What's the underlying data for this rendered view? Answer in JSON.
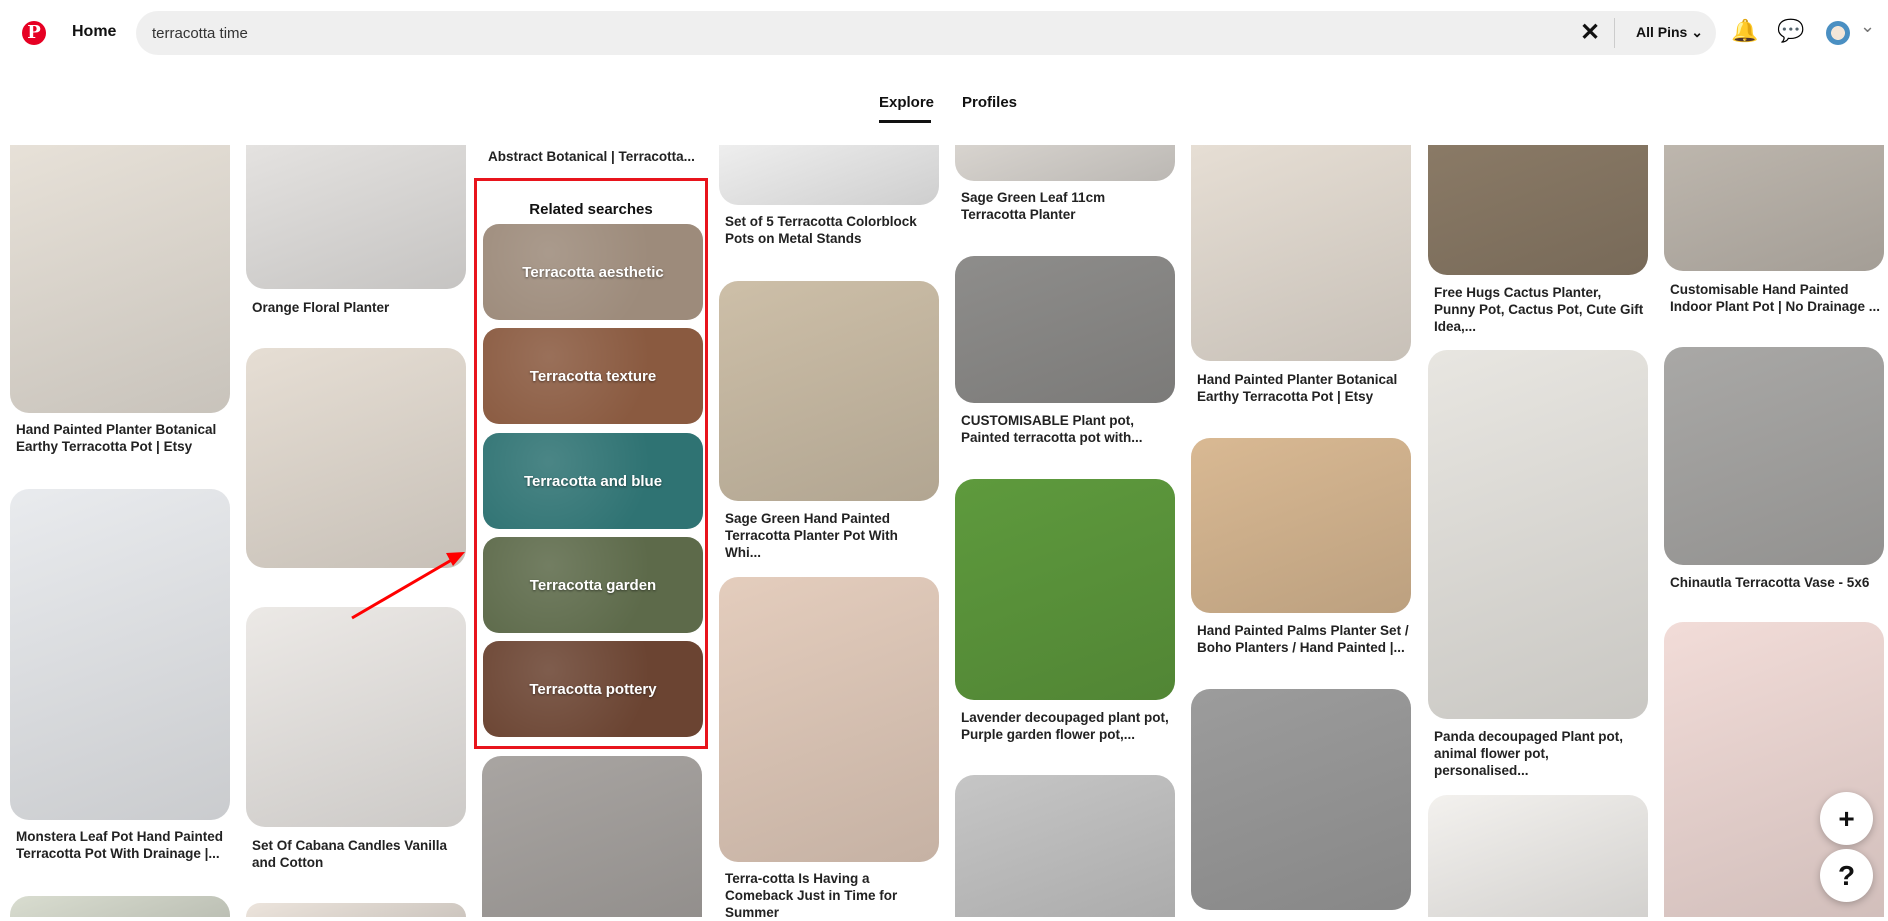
{
  "header": {
    "logo": "P",
    "home": "Home",
    "search_value": "terracotta time",
    "filter": "All Pins",
    "filter_chevron": "⌄",
    "clear": "✕",
    "bell": "🔔",
    "chat": "💬",
    "menu_chevron": "⌄"
  },
  "tabs": [
    {
      "label": "Explore",
      "active": true
    },
    {
      "label": "Profiles",
      "active": false
    }
  ],
  "columns": [
    [
      {
        "title": "Hand Painted Planter Botanical Earthy Terracotta Pot | Etsy",
        "color": "#e7e1d8"
      },
      {
        "title": "Monstera Leaf Pot Hand Painted Terracotta Pot With Drainage |...",
        "color": "#e9ebee"
      },
      {
        "title": "",
        "color": "#d9ddd0"
      }
    ],
    [
      {
        "title": "Orange Floral Planter",
        "color": "#e4e2e0"
      },
      {
        "title": "",
        "color": "#e6ded4"
      },
      {
        "title": "Set Of Cabana Candles Vanilla and Cotton",
        "color": "#ece9e6"
      },
      {
        "title": "",
        "color": "#ece4dc"
      }
    ],
    [
      {
        "title": "Abstract Botanical | Terracotta...",
        "color": "#ffffff"
      },
      {
        "title": "",
        "color": "#a9a5a2"
      }
    ],
    [
      {
        "title": "Set of 5 Terracotta Colorblock Pots on Metal Stands",
        "color": "#eeeeee"
      },
      {
        "title": "Sage Green Hand Painted Terracotta Planter Pot With Whi...",
        "color": "#cdbfa8"
      },
      {
        "title": "Terra-cotta Is Having a Comeback Just in Time for Summer",
        "color": "#e4cdbd"
      }
    ],
    [
      {
        "title": "Sage Green Leaf 11cm Terracotta Planter",
        "color": "#d8d4cf"
      },
      {
        "title": "CUSTOMISABLE Plant pot, Painted terracotta pot with...",
        "color": "#8e8d8b"
      },
      {
        "title": "Lavender decoupaged plant pot, Purple garden flower pot,...",
        "color": "#5e9a3d"
      },
      {
        "title": "",
        "color": "#c6c6c6"
      }
    ],
    [
      {
        "title": "Hand Painted Planter Botanical Earthy Terracotta Pot | Etsy",
        "color": "#e6ded4"
      },
      {
        "title": "Hand Painted Palms Planter Set / Boho Planters / Hand Painted |...",
        "color": "#d9b993"
      },
      {
        "title": "",
        "color": "#9c9c9c"
      }
    ],
    [
      {
        "title": "Free Hugs Cactus Planter, Punny Pot, Cactus Pot, Cute Gift Idea,...",
        "color": "#8a7a66"
      },
      {
        "title": "Panda decoupaged Plant pot, animal flower pot, personalised...",
        "color": "#e8e6e1"
      },
      {
        "title": "",
        "color": "#f3f1ee"
      }
    ],
    [
      {
        "title": "Customisable Hand Painted Indoor Plant Pot | No Drainage ...",
        "color": "#bdb6ad"
      },
      {
        "title": "Chinautla Terracotta Vase - 5x6",
        "color": "#a9a8a6"
      },
      {
        "title": "",
        "color": "#f2dcd8"
      }
    ]
  ],
  "related": {
    "title": "Related searches",
    "items": [
      {
        "label": "Terracotta aesthetic",
        "color": "#9d8b7b"
      },
      {
        "label": "Terracotta texture",
        "color": "#8a5a40"
      },
      {
        "label": "Terracotta and blue",
        "color": "#2f7373"
      },
      {
        "label": "Terracotta garden",
        "color": "#5d6a4a"
      },
      {
        "label": "Terracotta pottery",
        "color": "#6b4432"
      }
    ]
  },
  "fab": {
    "add": "+",
    "help": "?"
  },
  "colors": {
    "brand": "#e60023",
    "highlight": "#e8141c"
  }
}
